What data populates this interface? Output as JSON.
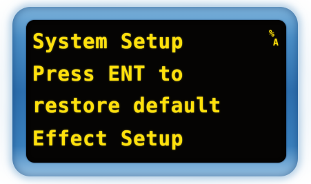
{
  "display": {
    "lines": [
      "System Setup",
      "Press ENT to",
      "restore default",
      "Effect Setup"
    ],
    "mode_icon": {
      "top": "%",
      "bottom": "A"
    },
    "text_color": "#ffe10a",
    "screen_color": "#050403",
    "bezel_color": "#2d6fae"
  }
}
